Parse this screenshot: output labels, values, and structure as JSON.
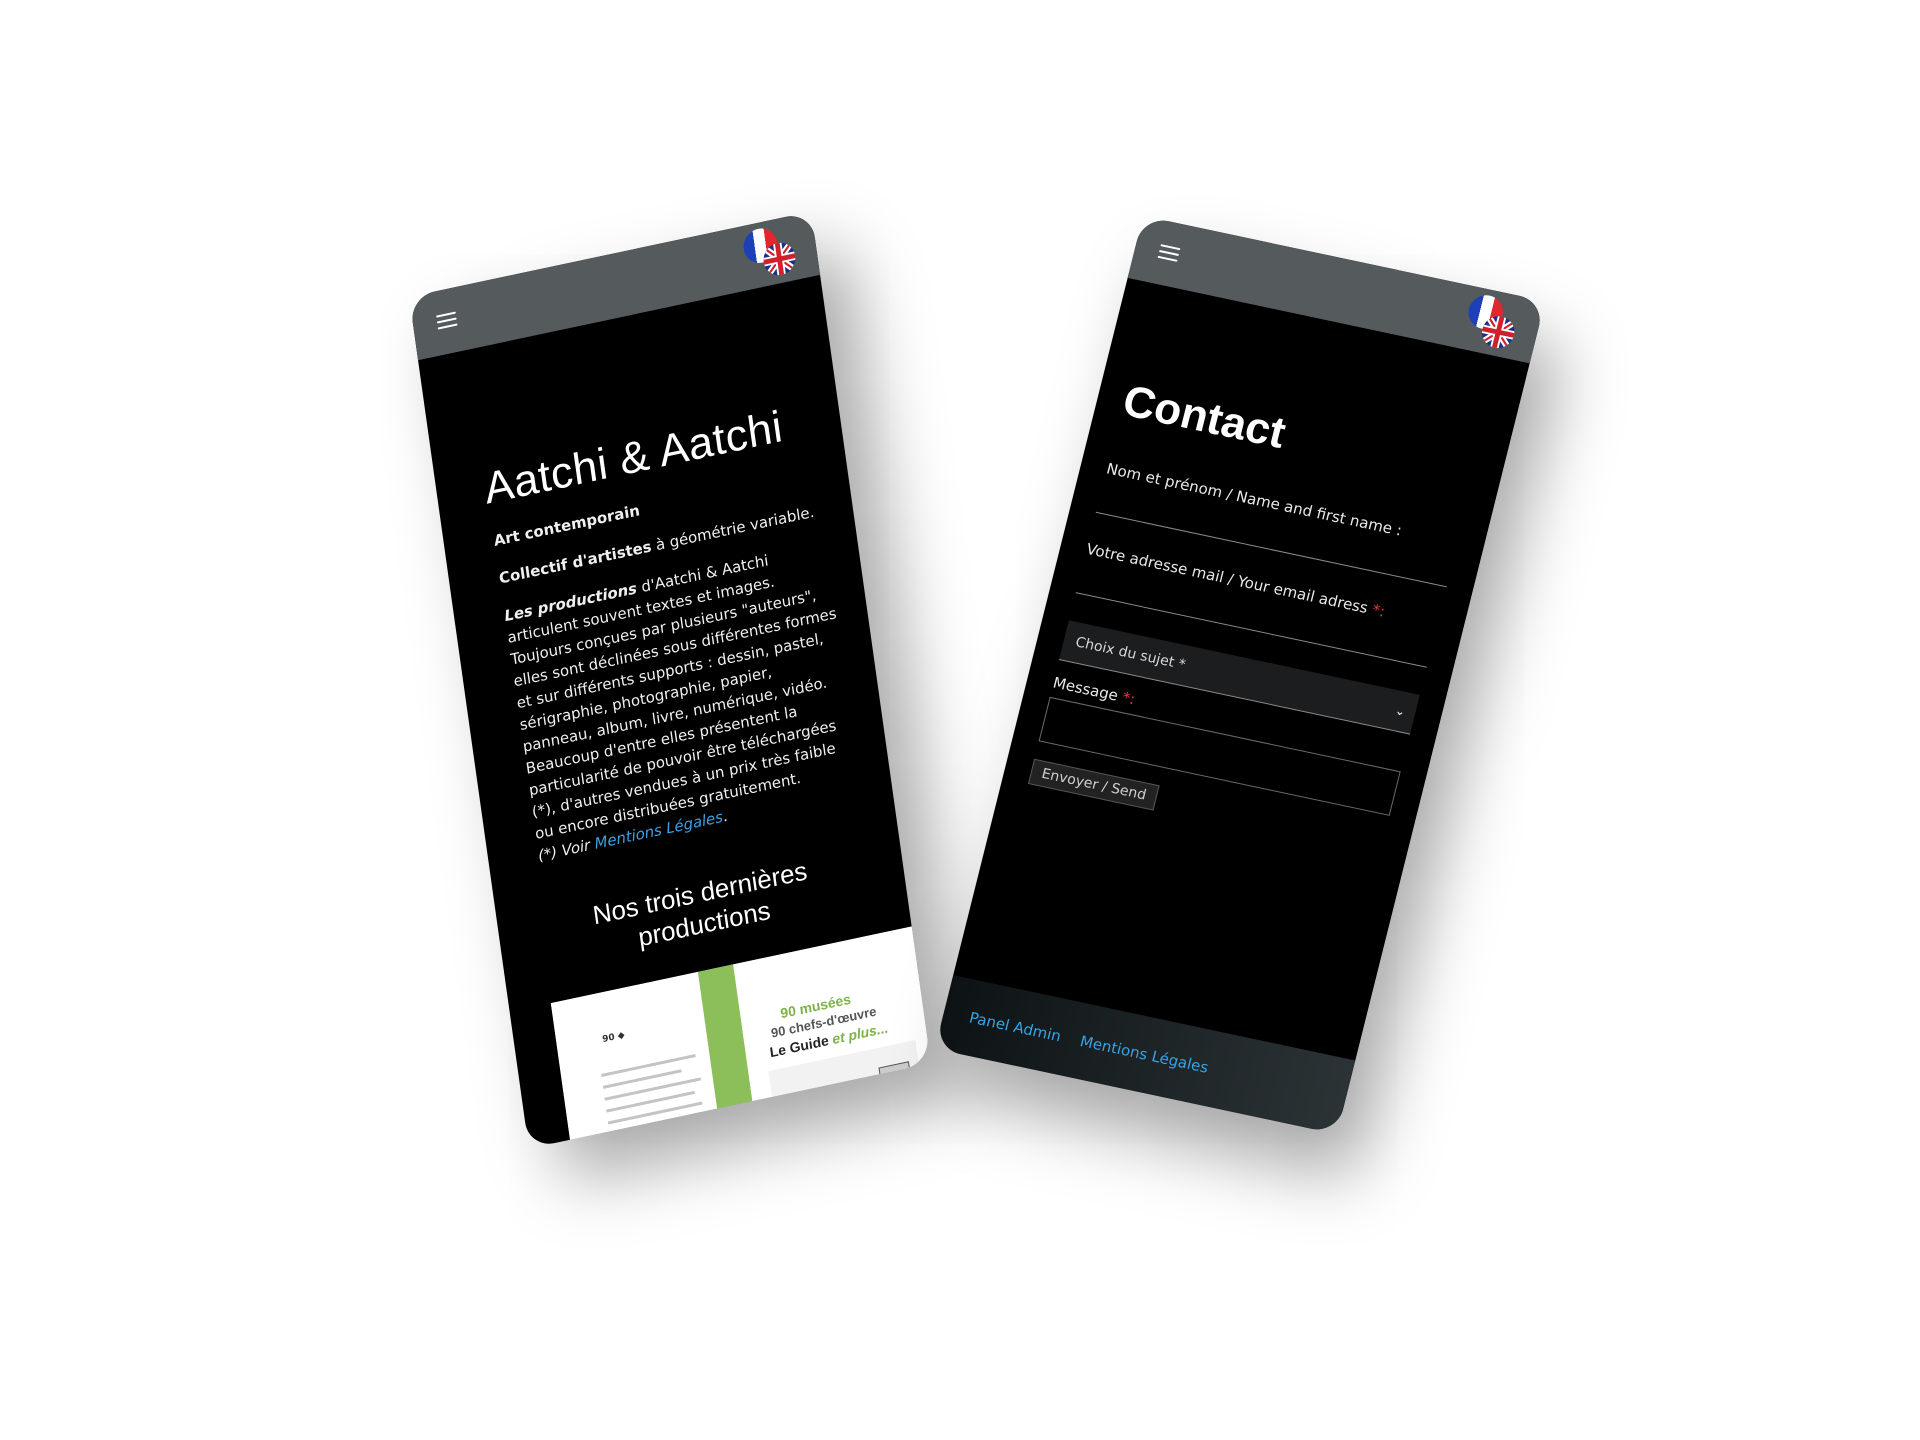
{
  "left_phone": {
    "title": "Aatchi & Aatchi",
    "tagline": "Art contemporain",
    "collective_bold": "Collectif d'artistes",
    "collective_rest": " à géométrie variable.",
    "productions_bold": "Les productions",
    "productions_rest": " d'Aatchi & Aatchi articulent souvent textes et images.",
    "paragraph_2": "Toujours conçues par plusieurs \"auteurs\", elles sont déclinées sous différentes formes et sur différents supports : dessin, pastel, sérigraphie, photographie, papier, panneau, album, livre, numérique, vidéo.",
    "paragraph_3": "Beaucoup d'entre elles présentent la particularité de pouvoir être téléchargées (*), d'autres vendues à un prix très faible ou encore distribuées gratuitement.",
    "note_prefix": "(*) Voir ",
    "note_link": "Mentions Légales",
    "note_suffix": ".",
    "section_title": "Nos trois dernières productions",
    "book": {
      "cover_line1": "90 musées",
      "cover_line2": "90 chefs-d'œuvre",
      "cover_line3": "Le Guide",
      "cover_line3_em": "et plus..."
    }
  },
  "right_phone": {
    "title": "Contact",
    "name_label": "Nom et prénom / Name and first name :",
    "email_label": "Votre adresse mail / Your email adress ",
    "email_req": "*:",
    "subject_placeholder": "Choix du sujet *",
    "message_label": "Message ",
    "message_req": "*:",
    "send_label": "Envoyer / Send",
    "footer": {
      "admin_link": "Panel Admin",
      "legal_link": "Mentions Légales"
    }
  },
  "colors": {
    "topbar": "#555a5d",
    "link": "#3aa3e8",
    "required": "#e23b3b",
    "book_green": "#8cbf5a"
  },
  "icons": [
    "hamburger-menu-icon",
    "french-flag-icon",
    "uk-flag-icon",
    "chevron-down-icon"
  ]
}
